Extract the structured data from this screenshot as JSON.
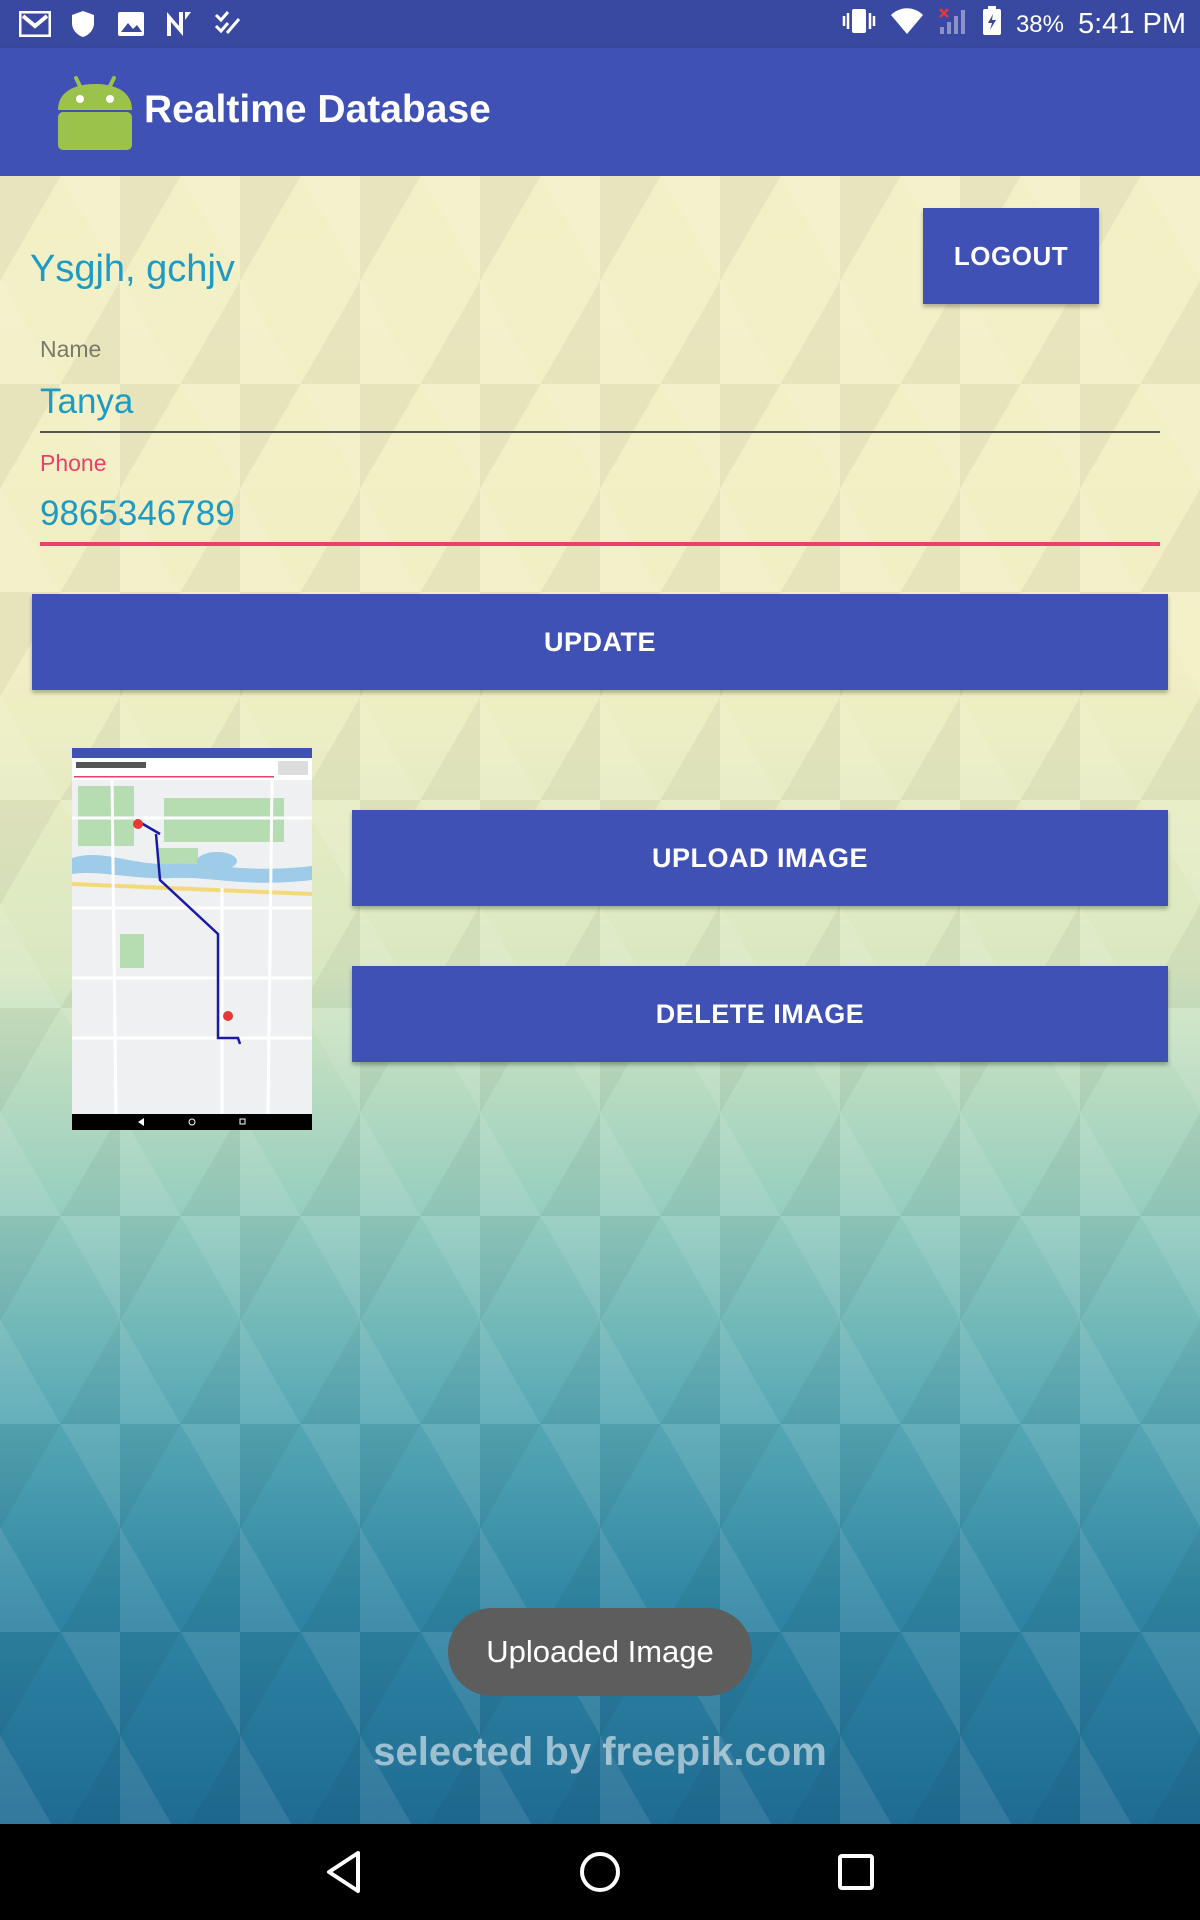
{
  "status_bar": {
    "left_icons": [
      "gmail-icon",
      "shield-icon",
      "image-icon",
      "n-icon",
      "checklist-icon"
    ],
    "right_icons": [
      "vibrate-icon",
      "wifi-icon",
      "signal-icon",
      "battery-icon"
    ],
    "battery": "38%",
    "time": "5:41 PM"
  },
  "app_bar": {
    "title": "Realtime Database",
    "logo_icon": "android-icon"
  },
  "main": {
    "greeting": "Ysgjh, gchjv",
    "logout_label": "LOGOUT",
    "name_label": "Name",
    "name_value": "Tanya",
    "phone_label": "Phone",
    "phone_value": "9865346789",
    "update_label": "UPDATE",
    "upload_label": "UPLOAD IMAGE",
    "delete_label": "DELETE IMAGE"
  },
  "toast": {
    "message": "Uploaded Image"
  },
  "background": {
    "watermark": "selected by freepik.com"
  },
  "nav_bar": {
    "buttons": [
      "back-icon",
      "home-icon",
      "recents-icon"
    ]
  },
  "colors": {
    "primary": "#3f51b5",
    "primary_dark": "#3949a1",
    "accent": "#e9416b",
    "text_teal": "#1e9bc4"
  }
}
